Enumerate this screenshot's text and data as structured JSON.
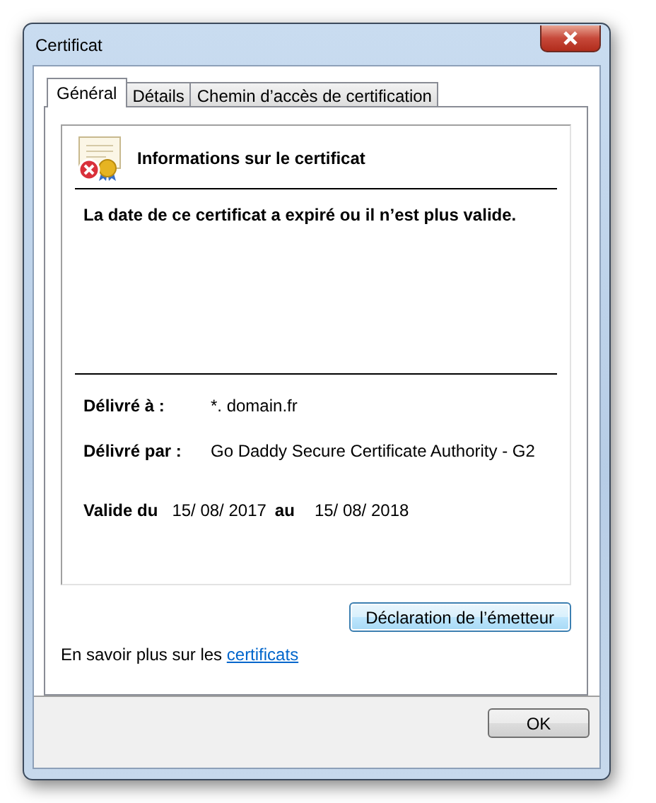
{
  "window": {
    "title": "Certificat"
  },
  "tabs": [
    {
      "label": "Général",
      "selected": true
    },
    {
      "label": "Détails",
      "selected": false
    },
    {
      "label": "Chemin d’accès de certification",
      "selected": false
    }
  ],
  "info": {
    "title": "Informations sur le certificat",
    "message": "La date de ce certificat a expiré ou il n’est plus valide.",
    "issued_to": {
      "label": "Délivré à :",
      "value": "*. domain.fr"
    },
    "issued_by": {
      "label": "Délivré par :",
      "value": "Go Daddy Secure Certificate Authority - G2"
    },
    "validity": {
      "from_label": "Valide du",
      "from": "15/ 08/ 2017",
      "to_label": "au",
      "to": "15/ 08/ 2018"
    }
  },
  "issuer_button": "Déclaration de l’émetteur",
  "learn_more": {
    "text": "En savoir plus sur les ",
    "link": "certificats"
  },
  "ok_button": "OK"
}
